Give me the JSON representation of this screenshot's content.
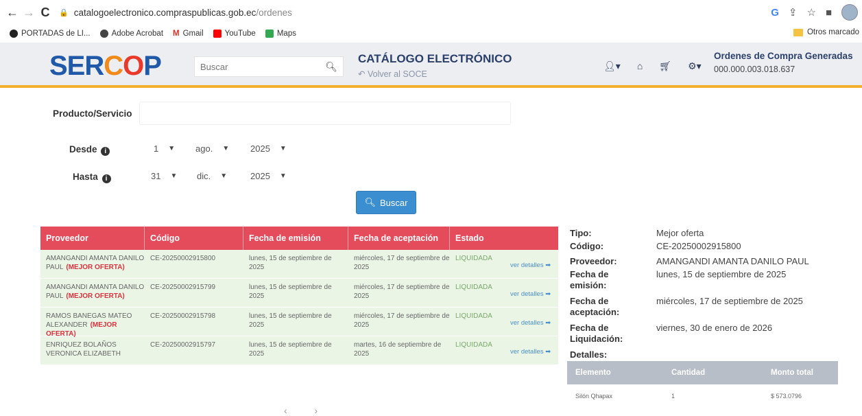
{
  "browser": {
    "url_host": "catalogoelectronico.compraspublicas.gob.ec",
    "url_path": "/ordenes",
    "bookmarks": [
      {
        "label": "PORTADAS de LI...",
        "color": "#222"
      },
      {
        "label": "Adobe Acrobat",
        "color": "#444"
      },
      {
        "label": "Gmail",
        "color": "#d93025"
      },
      {
        "label": "YouTube",
        "color": "#ff0000"
      },
      {
        "label": "Maps",
        "color": "#34a853"
      }
    ],
    "other_bookmarks": "Otros marcado"
  },
  "header": {
    "logo": {
      "part1": "SER",
      "part2": "C",
      "part3": "O",
      "part4": "P"
    },
    "search_placeholder": "Buscar",
    "catalog_title": "CATÁLOGO ELECTRÓNICO",
    "back_link": "Volver al SOCE",
    "orders_title": "Ordenes de Compra Generadas",
    "orders_number": "000.000.003.018.637"
  },
  "form": {
    "producto_label": "Producto/Servicio",
    "desde_label": "Desde",
    "hasta_label": "Hasta",
    "desde": {
      "day": "1",
      "month": "ago.",
      "year": "2025"
    },
    "hasta": {
      "day": "31",
      "month": "dic.",
      "year": "2025"
    },
    "buscar_label": "Buscar"
  },
  "table": {
    "headers": [
      "Proveedor",
      "Código",
      "Fecha de emisión",
      "Fecha de aceptación",
      "Estado"
    ],
    "rows": [
      {
        "proveedor": "AMANGANDI AMANTA DANILO PAUL",
        "mejor": "(MEJOR OFERTA)",
        "codigo": "CE-20250002915800",
        "emision": "lunes, 15 de septiembre de 2025",
        "aceptacion": "miércoles, 17 de septiembre de 2025",
        "estado": "LIQUIDADA",
        "ver": "ver detalles"
      },
      {
        "proveedor": "AMANGANDI AMANTA DANILO PAUL",
        "mejor": "(MEJOR OFERTA)",
        "codigo": "CE-20250002915799",
        "emision": "lunes, 15 de septiembre de 2025",
        "aceptacion": "miércoles, 17 de septiembre de 2025",
        "estado": "LIQUIDADA",
        "ver": "ver detalles"
      },
      {
        "proveedor": "RAMOS BANEGAS MATEO ALEXANDER",
        "mejor": "(MEJOR OFERTA)",
        "codigo": "CE-20250002915798",
        "emision": "lunes, 15 de septiembre de 2025",
        "aceptacion": "miércoles, 17 de septiembre de 2025",
        "estado": "LIQUIDADA",
        "ver": "ver detalles"
      },
      {
        "proveedor": "ENRIQUEZ BOLAÑOS VERONICA ELIZABETH",
        "mejor": "",
        "codigo": "CE-20250002915797",
        "emision": "lunes, 15 de septiembre de 2025",
        "aceptacion": "martes, 16 de septiembre de 2025",
        "estado": "LIQUIDADA",
        "ver": "ver detalles"
      }
    ]
  },
  "detail": {
    "labels": {
      "tipo": "Tipo:",
      "codigo": "Código:",
      "proveedor": "Proveedor:",
      "emision": "Fecha de emisión:",
      "aceptacion": "Fecha de aceptación:",
      "liquidacion": "Fecha de Liquidación:",
      "detalles": "Detalles:"
    },
    "values": {
      "tipo": "Mejor oferta",
      "codigo": "CE-20250002915800",
      "proveedor": "AMANGANDI AMANTA DANILO PAUL",
      "emision": "lunes, 15 de septiembre de 2025",
      "aceptacion": "miércoles, 17 de septiembre de 2025",
      "liquidacion": "viernes, 30 de enero de 2026"
    },
    "items_headers": [
      "Elemento",
      "Cantidad",
      "Monto total"
    ],
    "items": [
      {
        "elemento": "Silón Qhapax",
        "cantidad": "1",
        "monto": "$ 573.0796"
      }
    ]
  },
  "pager": "‹ ›"
}
